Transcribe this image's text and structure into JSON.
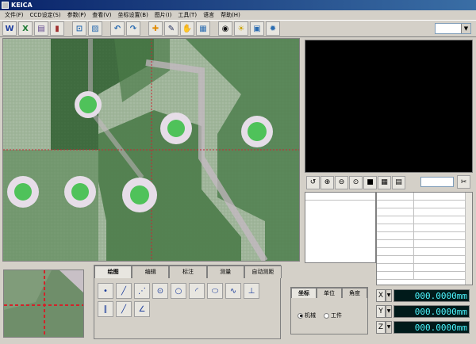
{
  "window": {
    "title": "KEICA"
  },
  "menu": [
    "文件(F)",
    "CCD设定(S)",
    "参数(P)",
    "查看(V)",
    "坐标设置(B)",
    "图片(I)",
    "工具(T)",
    "语言",
    "帮助(H)"
  ],
  "toolbar": {
    "buttons": [
      {
        "name": "word-export",
        "glyph": "W",
        "color": "#1f3f9f"
      },
      {
        "name": "excel-export",
        "glyph": "X",
        "color": "#1e7b34"
      },
      {
        "name": "save",
        "glyph": "▤",
        "color": "#5a3f8a"
      },
      {
        "name": "chart",
        "glyph": "▮",
        "color": "#a03030"
      },
      {
        "name": "auto-focus",
        "glyph": "⊡",
        "color": "#2b6cb0"
      },
      {
        "name": "scale",
        "glyph": "▨",
        "color": "#2b6cb0"
      },
      {
        "name": "undo",
        "glyph": "↶",
        "color": "#2b6cb0"
      },
      {
        "name": "redo",
        "glyph": "↷",
        "color": "#2b6cb0"
      },
      {
        "name": "crosshair",
        "glyph": "✚",
        "color": "#e08a00"
      },
      {
        "name": "pen",
        "glyph": "✎",
        "color": "#1e2a5a"
      },
      {
        "name": "hand",
        "glyph": "✋",
        "color": "#333"
      },
      {
        "name": "grid",
        "glyph": "▦",
        "color": "#2b6cb0"
      },
      {
        "name": "camera",
        "glyph": "◉",
        "color": "#111"
      },
      {
        "name": "light",
        "glyph": "☀",
        "color": "#c9a000"
      },
      {
        "name": "window",
        "glyph": "▣",
        "color": "#2b6cb0"
      },
      {
        "name": "settings",
        "glyph": "✹",
        "color": "#2b6cb0"
      }
    ]
  },
  "zoombar": {
    "buttons": [
      {
        "name": "reset",
        "glyph": "↺"
      },
      {
        "name": "zoom-in",
        "glyph": "⊕"
      },
      {
        "name": "zoom-out",
        "glyph": "⊖"
      },
      {
        "name": "zoom-fit",
        "glyph": "⊙"
      },
      {
        "name": "block",
        "glyph": "■"
      },
      {
        "name": "color-grid",
        "glyph": "▦"
      },
      {
        "name": "blue-grid",
        "glyph": "▤"
      }
    ]
  },
  "measure_tabs": [
    "绘图",
    "编辑",
    "标注",
    "测量",
    "自动测距"
  ],
  "measure_tools": {
    "row1": [
      {
        "name": "point",
        "glyph": "•"
      },
      {
        "name": "line",
        "glyph": "╱"
      },
      {
        "name": "dashed-line",
        "glyph": "⋰"
      },
      {
        "name": "circle-center",
        "glyph": "⊙"
      },
      {
        "name": "circle",
        "glyph": "○"
      },
      {
        "name": "arc",
        "glyph": "◜"
      },
      {
        "name": "ellipse",
        "glyph": "⬭"
      },
      {
        "name": "curve",
        "glyph": "∿"
      },
      {
        "name": "perpendicular",
        "glyph": "⊥"
      }
    ],
    "row2": [
      {
        "name": "parallel",
        "glyph": "∥"
      },
      {
        "name": "slash",
        "glyph": "╱"
      },
      {
        "name": "angle",
        "glyph": "∠"
      }
    ]
  },
  "coord_tabs": [
    "坐标",
    "单位",
    "角度"
  ],
  "coord_mode": {
    "options": [
      "机械",
      "工件"
    ],
    "selected": "机械"
  },
  "readouts": [
    {
      "axis": "X",
      "value": "000.0000mm"
    },
    {
      "axis": "Y",
      "value": "000.0000mm"
    },
    {
      "axis": "Z",
      "value": "000.0000mm"
    }
  ]
}
